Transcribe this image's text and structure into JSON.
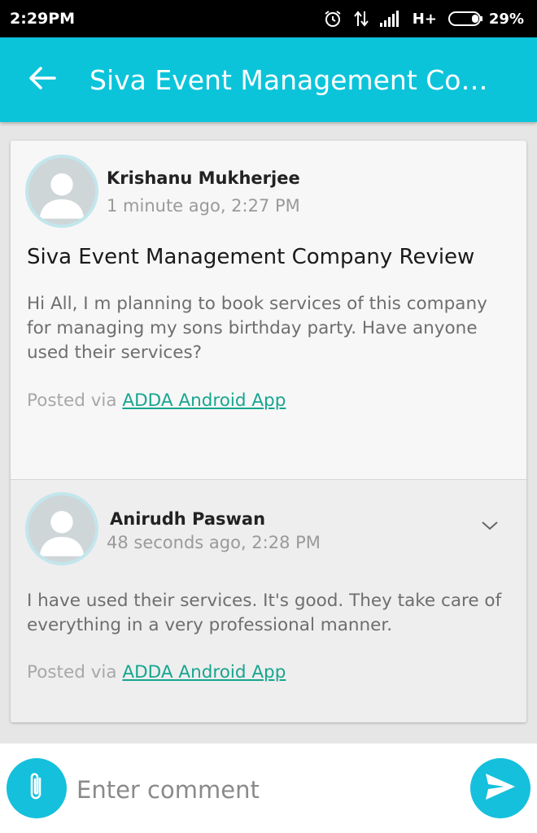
{
  "status_bar": {
    "time": "2:29PM",
    "network": "H+",
    "battery": "29%",
    "icons": [
      "alarm-icon",
      "data-transfer-icon",
      "signal-icon",
      "battery-icon"
    ]
  },
  "app_bar": {
    "title": "Siva Event Management Com...",
    "back_icon": "arrow-left-icon"
  },
  "post": {
    "author": "Krishanu Mukherjee",
    "timestamp": "1 minute ago, 2:27 PM",
    "title": "Siva Event Management Company Review",
    "body": "Hi All, I m planning to book services of this company for managing my sons birthday party. Have anyone used their services?",
    "posted_via_prefix": "Posted via ",
    "posted_via_link": "ADDA Android App"
  },
  "comment": {
    "author": "Anirudh Paswan",
    "timestamp": "48 seconds ago, 2:28 PM",
    "body": "I have used their services. It's good. They take care of everything in a very professional manner.",
    "posted_via_prefix": "Posted via ",
    "posted_via_link": "ADDA Android App",
    "menu_icon": "chevron-down-icon"
  },
  "composer": {
    "placeholder": "Enter comment",
    "attach_icon": "paperclip-icon",
    "send_icon": "send-icon"
  },
  "colors": {
    "app_bar": "#0cc4da",
    "fab": "#14c0dc",
    "link": "#17a58f",
    "avatar_ring": "#c2e6ec"
  }
}
